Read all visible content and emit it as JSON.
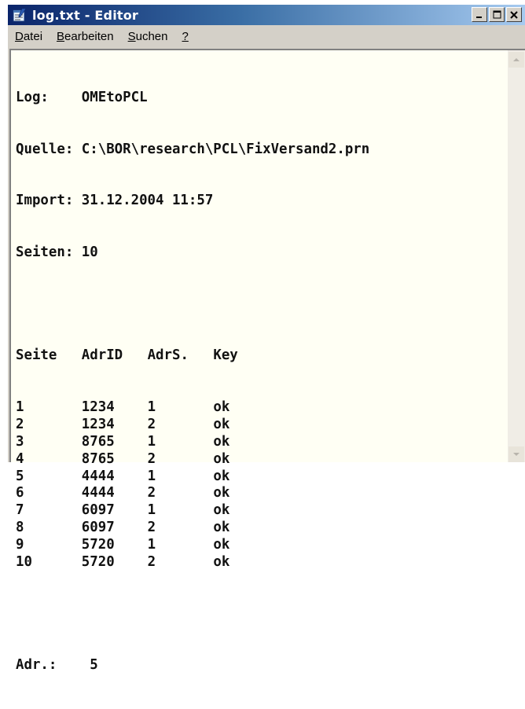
{
  "window": {
    "title": "log.txt - Editor"
  },
  "menu": {
    "datei": "Datei",
    "bearbeiten": "Bearbeiten",
    "suchen": "Suchen",
    "help": "?"
  },
  "header": {
    "log_label": "Log:",
    "log_value": "OMEtoPCL",
    "quelle_label": "Quelle:",
    "quelle_value": "C:\\BOR\\research\\PCL\\FixVersand2.prn",
    "import_label": "Import:",
    "import_value": "31.12.2004 11:57",
    "seiten_label": "Seiten:",
    "seiten_value": "10"
  },
  "table": {
    "columns": [
      "Seite",
      "AdrID",
      "AdrS.",
      "Key"
    ],
    "rows": [
      [
        "1",
        "1234",
        "1",
        "ok"
      ],
      [
        "2",
        "1234",
        "2",
        "ok"
      ],
      [
        "3",
        "8765",
        "1",
        "ok"
      ],
      [
        "4",
        "8765",
        "2",
        "ok"
      ],
      [
        "5",
        "4444",
        "1",
        "ok"
      ],
      [
        "6",
        "4444",
        "2",
        "ok"
      ],
      [
        "7",
        "6097",
        "1",
        "ok"
      ],
      [
        "8",
        "6097",
        "2",
        "ok"
      ],
      [
        "9",
        "5720",
        "1",
        "ok"
      ],
      [
        "10",
        "5720",
        "2",
        "ok"
      ]
    ]
  },
  "footer": {
    "adr_label": "Adr.:",
    "adr_value": "5"
  },
  "icons": {
    "app": "notepad-icon",
    "minimize": "minimize-icon",
    "maximize": "maximize-icon",
    "close": "close-icon",
    "scroll_up": "scroll-up-icon",
    "scroll_down": "scroll-down-icon"
  }
}
